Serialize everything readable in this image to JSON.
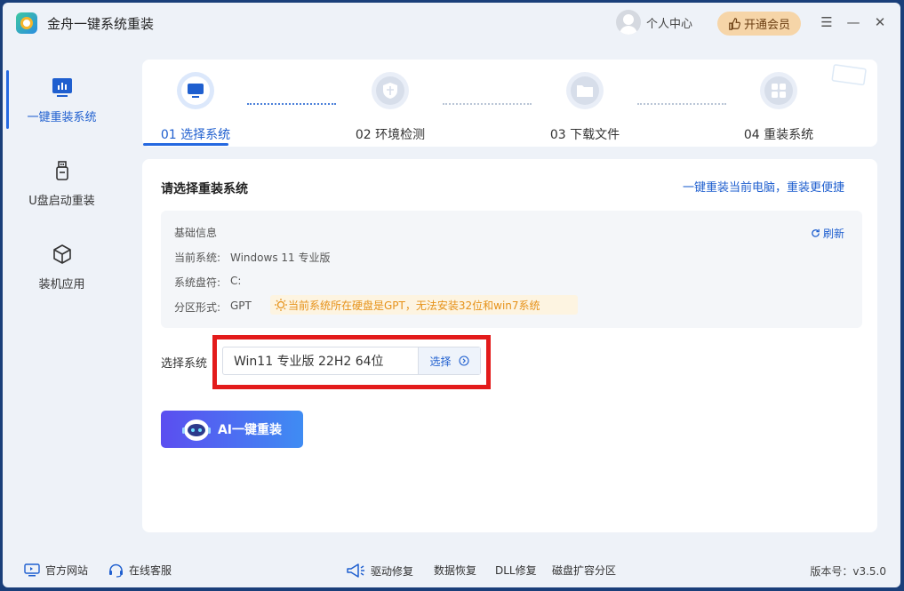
{
  "app": {
    "title": "金舟一键系统重装"
  },
  "header": {
    "user_center": "个人中心",
    "vip_label": "开通会员",
    "controls": [
      "menu-icon",
      "minimize-icon",
      "close-icon"
    ]
  },
  "sidebar": {
    "items": [
      {
        "label": "一键重装系统",
        "icon": "bar-chart-icon",
        "active": true
      },
      {
        "label": "U盘启动重装",
        "icon": "usb-icon",
        "active": false
      },
      {
        "label": "装机应用",
        "icon": "cube-icon",
        "active": false
      }
    ]
  },
  "steps": [
    {
      "label": "01 选择系统",
      "icon": "monitor-icon",
      "active": true
    },
    {
      "label": "02 环境检测",
      "icon": "shield-icon",
      "active": false
    },
    {
      "label": "03 下载文件",
      "icon": "folder-icon",
      "active": false
    },
    {
      "label": "04 重装系统",
      "icon": "grid-icon",
      "active": false
    }
  ],
  "main": {
    "section_title": "请选择重装系统",
    "quick_link": "一键重装当前电脑，重装更便捷",
    "info": {
      "title": "基础信息",
      "refresh": "刷新",
      "current_system_label": "当前系统:",
      "current_system_value": "Windows 11 专业版",
      "drive_label": "系统盘符:",
      "drive_value": "C:",
      "partition_label": "分区形式:",
      "partition_value": "GPT",
      "warning": "当前系统所在硬盘是GPT，无法安装32位和win7系统"
    },
    "select_label": "选择系统",
    "selected_system": "Win11 专业版 22H2 64位",
    "select_button": "选择",
    "ai_button": "AI一键重装"
  },
  "footer": {
    "website": "官方网站",
    "service": "在线客服",
    "tools": [
      "驱动修复",
      "数据恢复",
      "DLL修复",
      "磁盘扩容分区"
    ],
    "version": "版本号：v3.5.0"
  },
  "colors": {
    "accent": "#1f5fcf",
    "warning": "#e6921a",
    "highlight": "#e31b1b"
  }
}
